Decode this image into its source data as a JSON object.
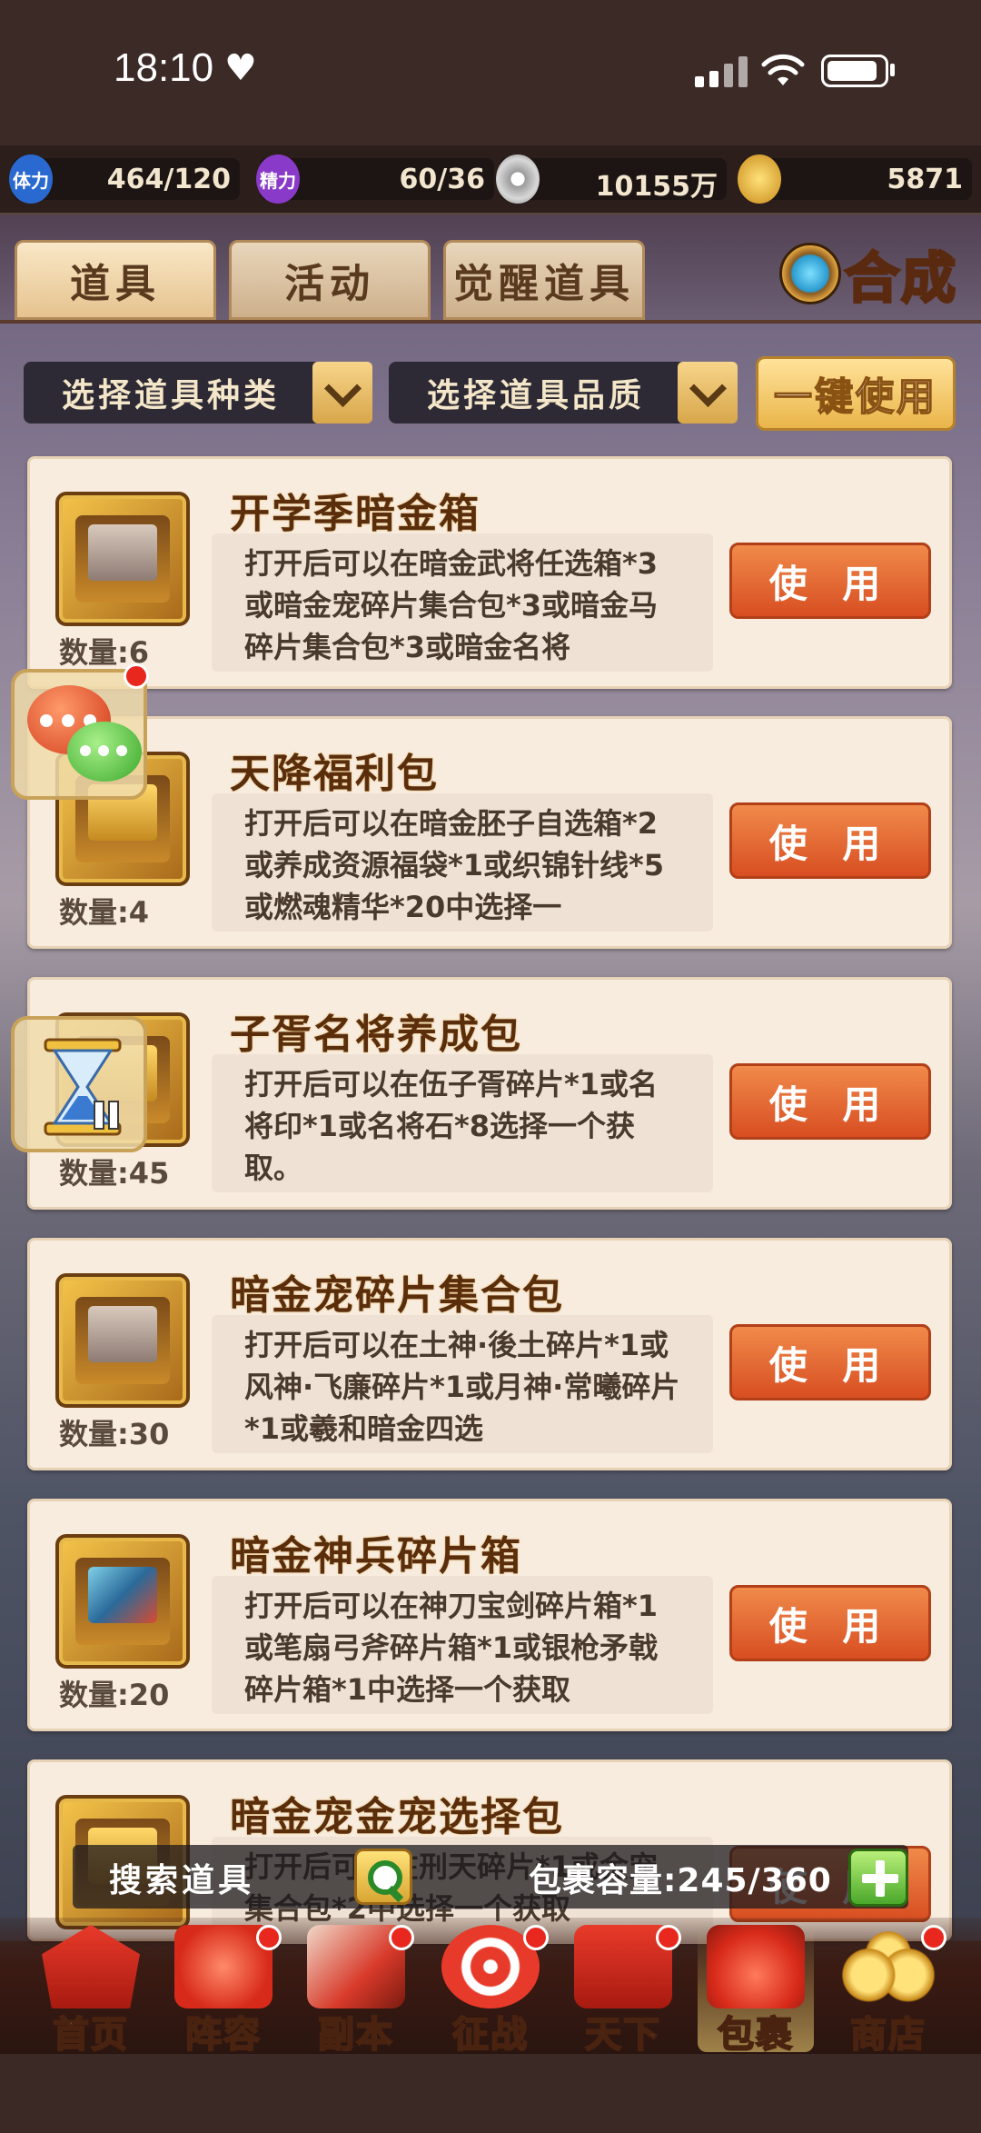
{
  "status_bar": {
    "time": "18:10",
    "heart": "♥"
  },
  "resources": [
    {
      "icon": "stamina-icon",
      "icon_text": "体力",
      "value": "464/120",
      "color": "#2a6ad0"
    },
    {
      "icon": "energy-icon",
      "icon_text": "精力",
      "value": "60/36",
      "color": "#8a3ac8"
    },
    {
      "icon": "coin-icon",
      "icon_text": "",
      "value": "10155万",
      "color": "#b8b8b8"
    },
    {
      "icon": "gold-ingot-icon",
      "icon_text": "",
      "value": "5871",
      "color": "#e0a030"
    }
  ],
  "tabs": [
    "道具",
    "活动",
    "觉醒道具"
  ],
  "hecheng_label": "合成",
  "filters": {
    "type_label": "选择道具种类",
    "quality_label": "选择道具品质",
    "use_all_label": "一键使用"
  },
  "items": [
    {
      "name": "开学季暗金箱",
      "desc": "打开后可以在暗金武将任选箱*3或暗金宠碎片集合包*3或暗金马碎片集合包*3或暗金名将",
      "count": "数量:6",
      "use_label": "使 用"
    },
    {
      "name": "天降福利包",
      "desc": "打开后可以在暗金胚子自选箱*2或养成资源福袋*1或织锦针线*5或燃魂精华*20中选择一",
      "count": "数量:4",
      "use_label": "使 用"
    },
    {
      "name": "子胥名将养成包",
      "desc": "打开后可以在伍子胥碎片*1或名将印*1或名将石*8选择一个获取。",
      "count": "数量:45",
      "use_label": "使 用"
    },
    {
      "name": "暗金宠碎片集合包",
      "desc": "打开后可以在土神·後土碎片*1或风神·飞廉碎片*1或月神·常曦碎片*1或羲和暗金四选",
      "count": "数量:30",
      "use_label": "使 用"
    },
    {
      "name": "暗金神兵碎片箱",
      "desc": "打开后可以在神刀宝剑碎片箱*1或笔扇弓斧碎片箱*1或银枪矛戟碎片箱*1中选择一个获取",
      "count": "数量:20",
      "use_label": "使 用"
    },
    {
      "name": "暗金宠金宠选择包",
      "desc": "打开后可以在刑天碎片*1或金宠集合包*2中选择一个获取",
      "count": "",
      "use_label": "使 用"
    }
  ],
  "search": {
    "label": "搜索道具",
    "capacity": "包裹容量:245/360"
  },
  "nav": [
    {
      "label": "首页",
      "dot": false
    },
    {
      "label": "阵容",
      "dot": true
    },
    {
      "label": "副本",
      "dot": true
    },
    {
      "label": "征战",
      "dot": true
    },
    {
      "label": "天下",
      "dot": true
    },
    {
      "label": "包裹",
      "dot": false,
      "active": true
    },
    {
      "label": "商店",
      "dot": true
    }
  ]
}
